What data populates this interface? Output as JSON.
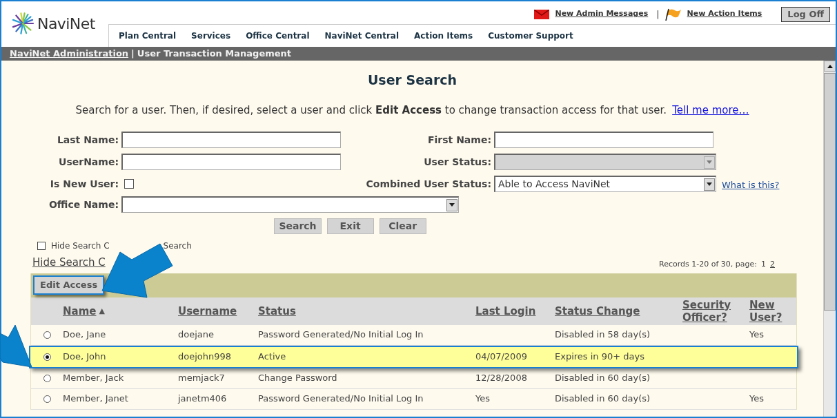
{
  "header": {
    "logo_text": "NaviNet",
    "top_links": [
      {
        "kind": "mail",
        "label": "New Admin Messages"
      },
      {
        "kind": "flag",
        "label": "New Action Items"
      }
    ],
    "top_separator": "|",
    "logoff": "Log Off",
    "nav_tabs": [
      "Plan Central",
      "Services",
      "Office Central",
      "NaviNet Central",
      "Action Items",
      "Customer Support"
    ]
  },
  "breadcrumb": {
    "link": "NaviNet Administration",
    "separator": "|",
    "current": "User Transaction Management"
  },
  "title": "User Search",
  "intro": {
    "text": "Search for a user. Then, if desired, select a user and click **Edit Access** to change transaction access for that user.",
    "link": "Tell me more…"
  },
  "fields": [
    {
      "kind": "text",
      "label": "Last Name:"
    },
    {
      "kind": "text",
      "label": "First Name:"
    },
    {
      "kind": "text",
      "label": "UserName:"
    },
    {
      "kind": "select",
      "label": "User Status:",
      "disabled": true
    },
    {
      "kind": "checkbox",
      "label": "Is New User:",
      "checked": false
    },
    {
      "kind": "select",
      "label": "Combined User Status:",
      "value": "Able to Access NaviNet",
      "disabled": false,
      "help": "What is this?"
    },
    {
      "kind": "select",
      "label": "Office Name:",
      "disabled": false,
      "wide": true
    }
  ],
  "buttons": [
    "Search",
    "Exit",
    "Clear"
  ],
  "hide_criteria": {
    "checked": false,
    "visible_parts": [
      "Hide Search C",
      "Search"
    ]
  },
  "hide_link": "Hide Search C",
  "records": {
    "text": "Records 1-20 of 30, page:",
    "pages": [
      {
        "label": "1",
        "selected": true
      },
      {
        "label": "2",
        "selected": false
      }
    ]
  },
  "edit_button": "Edit Access",
  "table": {
    "columns": [
      {
        "label": "Name",
        "sort": "▲"
      },
      {
        "label": "Username"
      },
      {
        "label": "Status"
      },
      {
        "label": "Last Login"
      },
      {
        "label": "Status Change"
      },
      {
        "label": "Security Officer?"
      },
      {
        "label": "New User?"
      }
    ],
    "rows": [
      {
        "selected": false,
        "cells": [
          "Doe, Jane",
          "doejane",
          "Password Generated/No Initial Log In",
          "",
          "Disabled in 58 day(s)",
          "",
          "Yes"
        ]
      },
      {
        "selected": true,
        "cells": [
          "Doe, John",
          "doejohn998",
          "Active",
          "04/07/2009",
          "Expires in 90+ days",
          "",
          ""
        ]
      },
      {
        "selected": false,
        "cells": [
          "Member, Jack",
          "memjack7",
          "Change Password",
          "12/28/2008",
          "Disabled in 60 day(s)",
          "",
          ""
        ]
      },
      {
        "selected": false,
        "cells": [
          "Member, Janet",
          "janetm406",
          "Password Generated/No Initial Log In",
          "Yes",
          "Disabled in 60 day(s)",
          "",
          "Yes"
        ]
      }
    ]
  }
}
